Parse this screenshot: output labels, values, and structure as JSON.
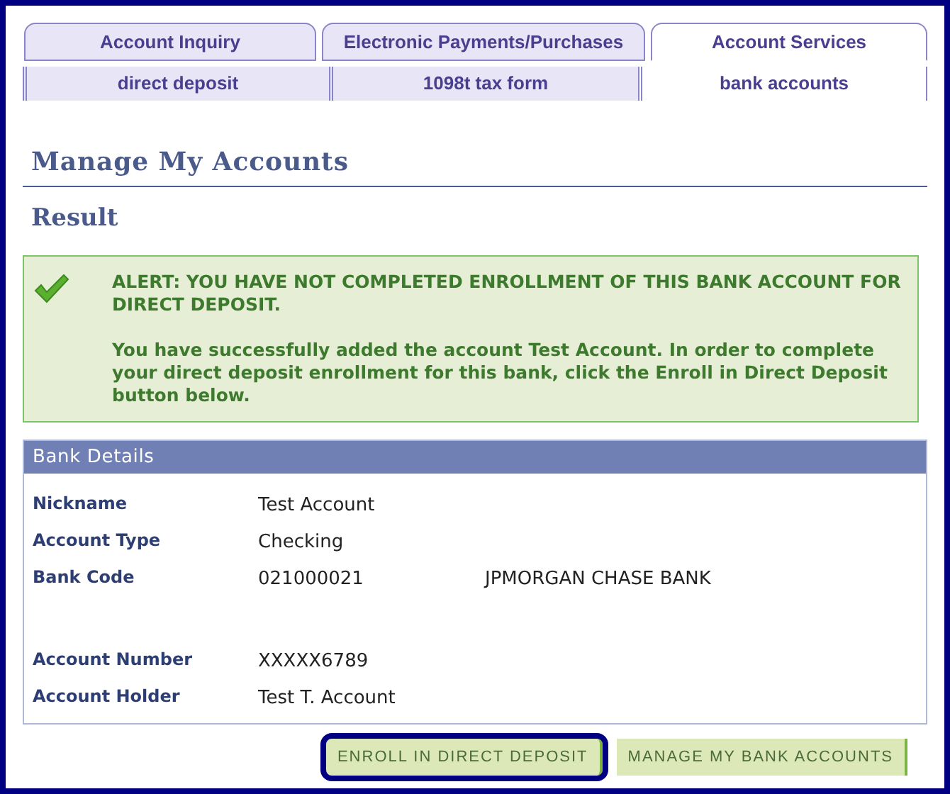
{
  "tabs": [
    {
      "label": "Account Inquiry",
      "selected": false
    },
    {
      "label": "Electronic Payments/Purchases",
      "selected": false
    },
    {
      "label": "Account Services",
      "selected": true
    }
  ],
  "subtabs": [
    {
      "label": "direct deposit",
      "selected": false
    },
    {
      "label": "1098t tax form",
      "selected": false
    },
    {
      "label": "bank accounts",
      "selected": true
    }
  ],
  "page_title": "Manage My Accounts",
  "section_title": "Result",
  "alert": {
    "heading": "ALERT: YOU HAVE NOT COMPLETED ENROLLMENT OF THIS BANK ACCOUNT FOR DIRECT DEPOSIT.",
    "message": "You have successfully added the account Test Account.  In order to complete your direct deposit enrollment for this bank, click the Enroll in Direct Deposit button below."
  },
  "bank_details": {
    "title": "Bank Details",
    "fields": [
      {
        "label": "Nickname",
        "value": "Test Account"
      },
      {
        "label": "Account Type",
        "value": "Checking"
      },
      {
        "label": "Bank Code",
        "value": "021000021",
        "extra": "JPMORGAN CHASE BANK"
      },
      {
        "label": "Account Number",
        "value": "XXXXX6789"
      },
      {
        "label": "Account Holder",
        "value": "Test T. Account"
      }
    ]
  },
  "buttons": [
    {
      "label": "ENROLL IN DIRECT DEPOSIT",
      "highlighted": true
    },
    {
      "label": "MANAGE MY BANK ACCOUNTS",
      "highlighted": false
    }
  ]
}
